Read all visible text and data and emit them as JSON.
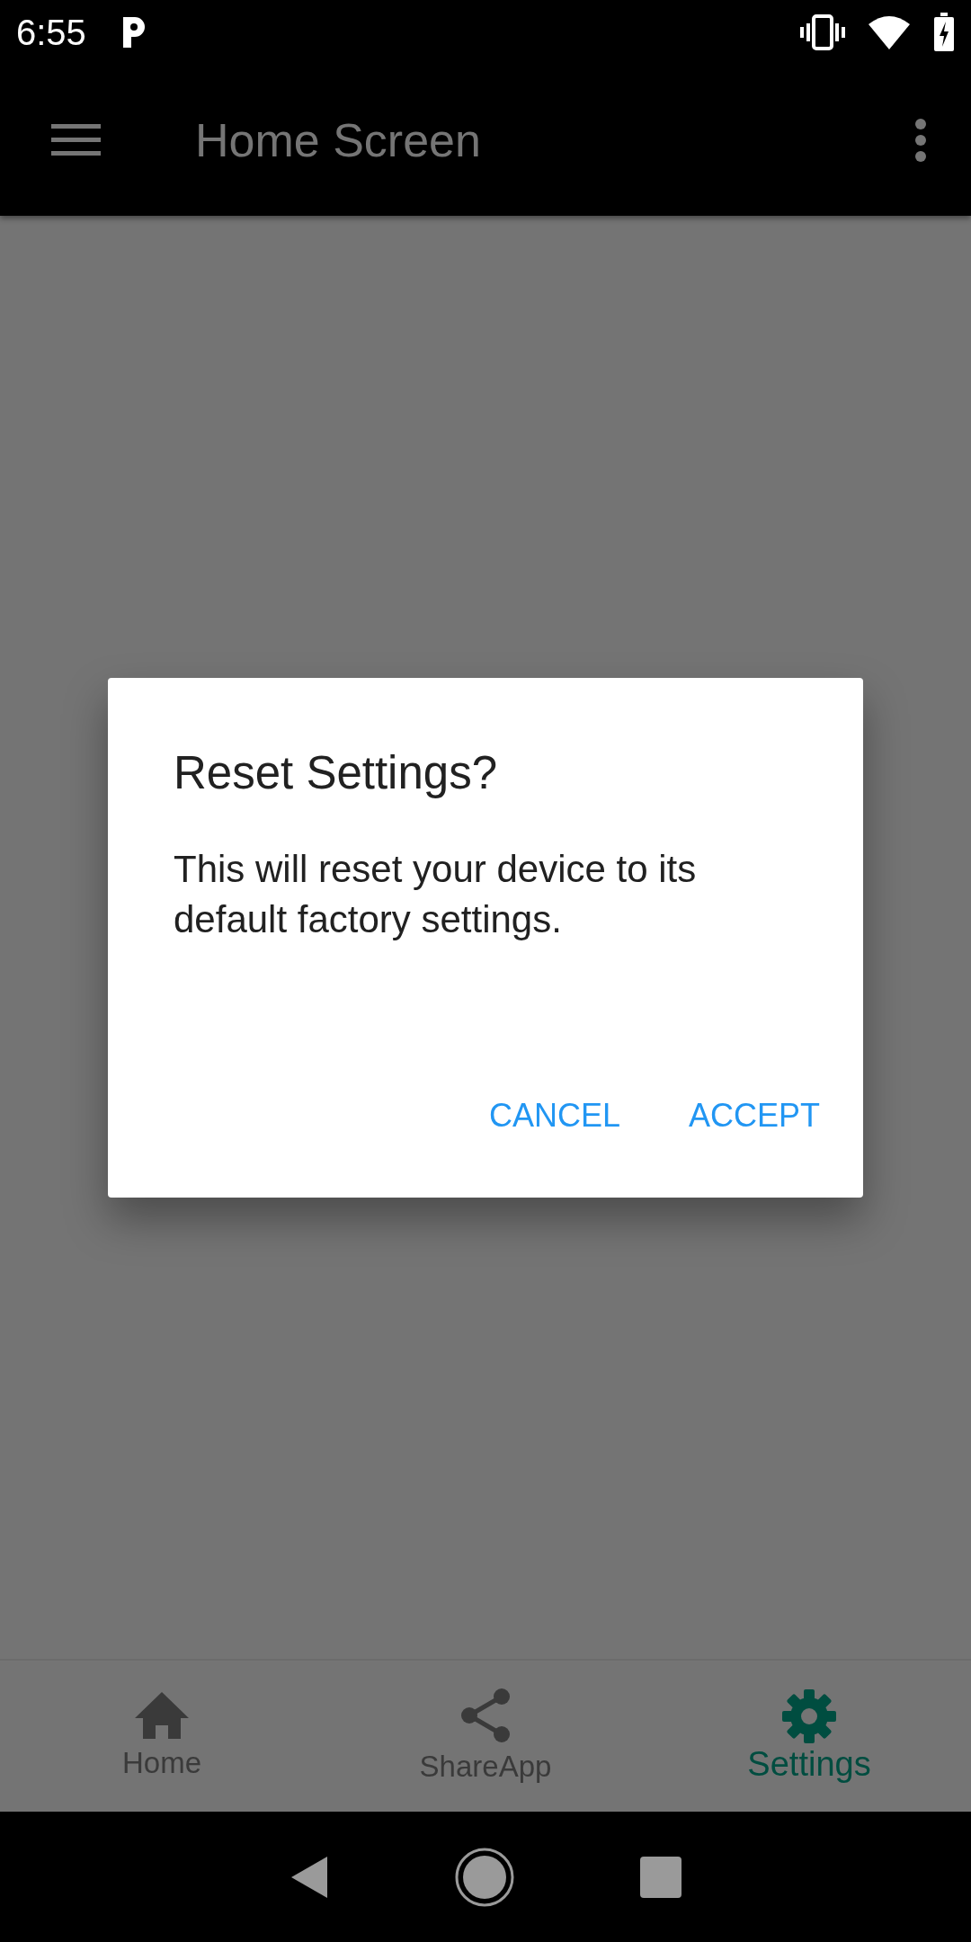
{
  "status_bar": {
    "time": "6:55"
  },
  "app_bar": {
    "title": "Home Screen"
  },
  "dialog": {
    "title": "Reset Settings?",
    "message": "This will reset your device to its default factory settings.",
    "buttons": [
      "CANCEL",
      "ACCEPT"
    ]
  },
  "bottom_nav": [
    {
      "label": "Home",
      "selected": false
    },
    {
      "label": "ShareApp",
      "selected": false
    },
    {
      "label": "Settings",
      "selected": true
    }
  ]
}
